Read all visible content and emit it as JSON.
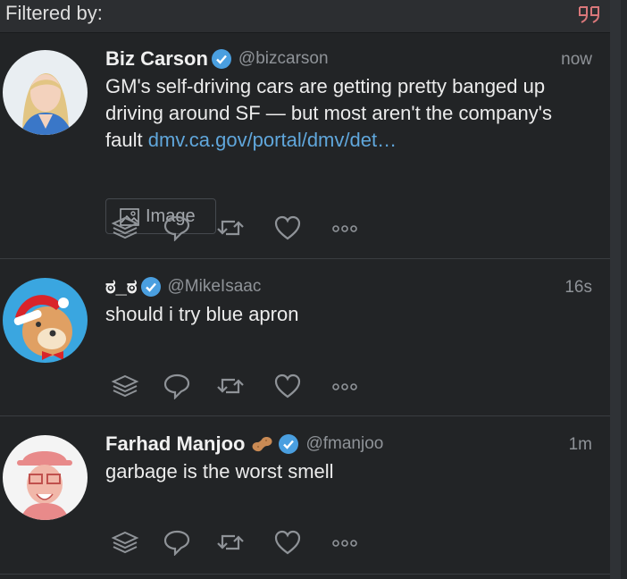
{
  "filter_bar": {
    "label": "Filtered by:",
    "icon": "quote-icon"
  },
  "tweets": [
    {
      "name": "Biz Carson",
      "handle": "@bizcarson",
      "time": "now",
      "verified": true,
      "text": "GM's self-driving cars are getting pretty banged up driving around SF — but most aren't the company's fault ",
      "link": "dmv.ca.gov/portal/dmv/det…",
      "media_label": "Image"
    },
    {
      "name": "ಠ_ಠ",
      "handle": "@MikeIsaac",
      "time": "16s",
      "verified": true,
      "text": "should i try blue apron"
    },
    {
      "name": "Farhad Manjoo",
      "name_emoji": "peanut-icon",
      "handle": "@fmanjoo",
      "time": "1m",
      "verified": true,
      "text": "garbage is the worst smell"
    }
  ],
  "actions": [
    "stack-icon",
    "reply-icon",
    "retweet-icon",
    "like-icon",
    "more-icon"
  ],
  "colors": {
    "background": "#222426",
    "link": "#60a7dc",
    "verified": "#4a9fe0",
    "secondary_text": "#8f9398"
  }
}
